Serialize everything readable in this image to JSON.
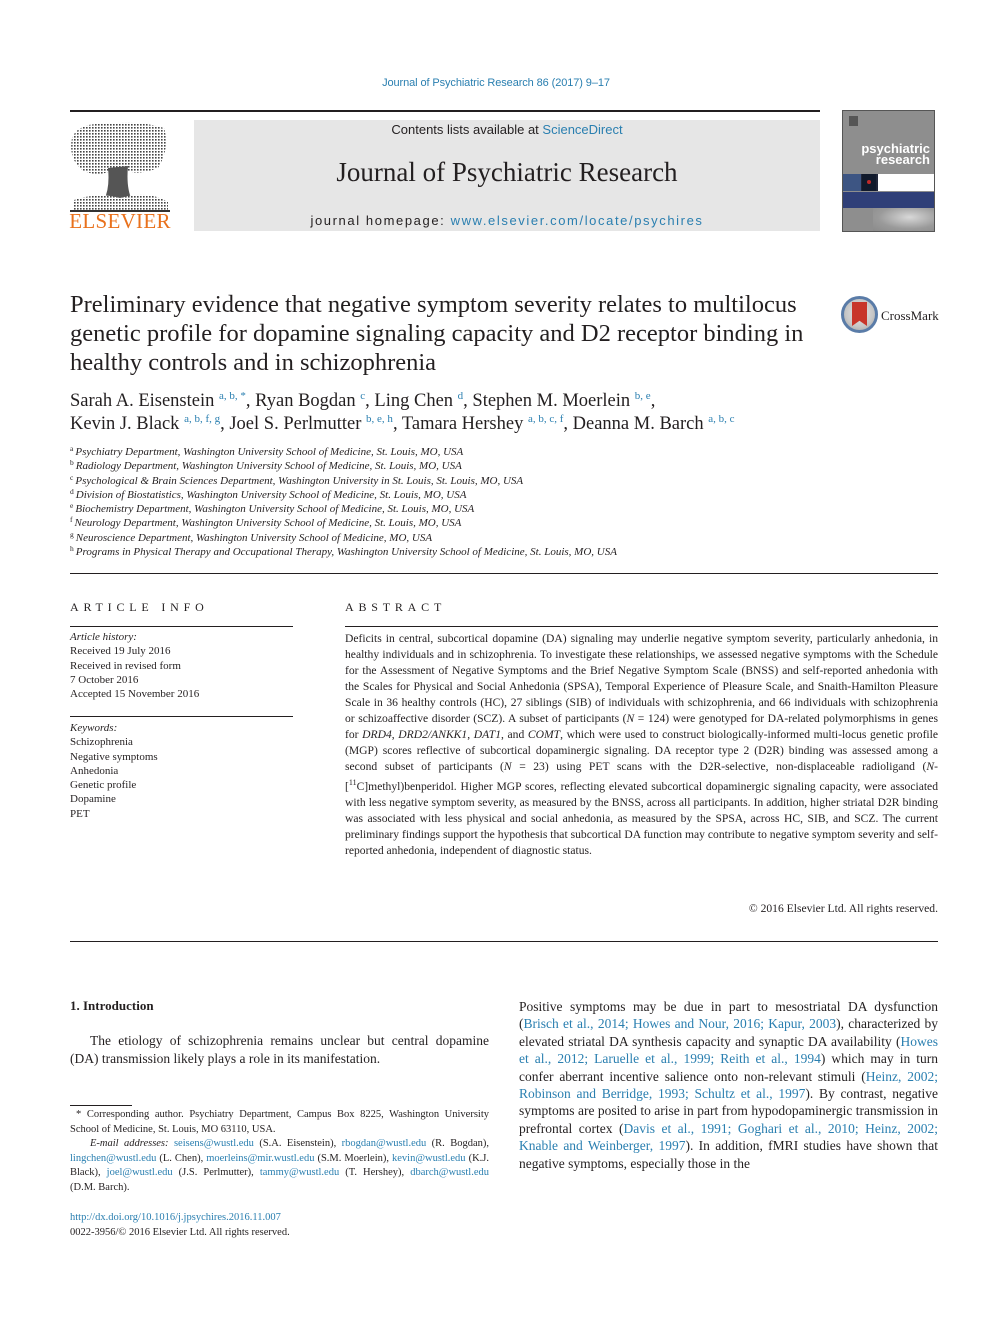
{
  "running_head": "Journal of Psychiatric Research 86 (2017) 9–17",
  "masthead": {
    "contents_prefix": "Contents lists available at ",
    "contents_link": "ScienceDirect",
    "journal_title": "Journal of Psychiatric Research",
    "homepage_prefix": "journal homepage: ",
    "homepage_link": "www.elsevier.com/locate/psychires",
    "publisher_logo": "ELSEVIER",
    "cover_title_line1": "psychiatric",
    "cover_title_line2": "research"
  },
  "crossmark_label": "CrossMark",
  "title": "Preliminary evidence that negative symptom severity relates to multilocus genetic profile for dopamine signaling capacity and D2 receptor binding in healthy controls and in schizophrenia",
  "authors": [
    {
      "name": "Sarah A. Eisenstein",
      "affil": "a, b, *",
      "sep": ", "
    },
    {
      "name": "Ryan Bogdan",
      "affil": "c",
      "sep": ", "
    },
    {
      "name": "Ling Chen",
      "affil": "d",
      "sep": ", "
    },
    {
      "name": "Stephen M. Moerlein",
      "affil": "b, e",
      "sep": ","
    },
    {
      "name": "Kevin J. Black",
      "affil": "a, b, f, g",
      "sep": ", "
    },
    {
      "name": "Joel S. Perlmutter",
      "affil": "b, e, h",
      "sep": ", "
    },
    {
      "name": "Tamara Hershey",
      "affil": "a, b, c, f",
      "sep": ", "
    },
    {
      "name": "Deanna M. Barch",
      "affil": "a, b, c",
      "sep": ""
    }
  ],
  "affiliations": [
    {
      "key": "a",
      "text": "Psychiatry Department, Washington University School of Medicine, St. Louis, MO, USA"
    },
    {
      "key": "b",
      "text": "Radiology Department, Washington University School of Medicine, St. Louis, MO, USA"
    },
    {
      "key": "c",
      "text": "Psychological & Brain Sciences Department, Washington University in St. Louis, St. Louis, MO, USA"
    },
    {
      "key": "d",
      "text": "Division of Biostatistics, Washington University School of Medicine, St. Louis, MO, USA"
    },
    {
      "key": "e",
      "text": "Biochemistry Department, Washington University School of Medicine, St. Louis, MO, USA"
    },
    {
      "key": "f",
      "text": "Neurology Department, Washington University School of Medicine, St. Louis, MO, USA"
    },
    {
      "key": "g",
      "text": "Neuroscience Department, Washington University School of Medicine, MO, USA"
    },
    {
      "key": "h",
      "text": "Programs in Physical Therapy and Occupational Therapy, Washington University School of Medicine, St. Louis, MO, USA"
    }
  ],
  "article_info": {
    "heading": "ARTICLE INFO",
    "history_label": "Article history:",
    "history": [
      "Received 19 July 2016",
      "Received in revised form",
      "7 October 2016",
      "Accepted 15 November 2016"
    ],
    "keywords_label": "Keywords:",
    "keywords": [
      "Schizophrenia",
      "Negative symptoms",
      "Anhedonia",
      "Genetic profile",
      "Dopamine",
      "PET"
    ]
  },
  "abstract": {
    "heading": "ABSTRACT",
    "p1": "Deficits in central, subcortical dopamine (DA) signaling may underlie negative symptom severity, particularly anhedonia, in healthy individuals and in schizophrenia. To investigate these relationships, we assessed negative symptoms with the Schedule for the Assessment of Negative Symptoms and the Brief Negative Symptom Scale (BNSS) and self-reported anhedonia with the Scales for Physical and Social Anhedonia (SPSA), Temporal Experience of Pleasure Scale, and Snaith-Hamilton Pleasure Scale in 36 healthy controls (HC), 27 siblings (SIB) of individuals with schizophrenia, and 66 individuals with schizophrenia or schizoaffective disorder (SCZ). A subset of participants (",
    "n1_var": "N",
    "n1_val": " = 124) were genotyped for DA-related polymorphisms in genes for ",
    "gene1": "DRD4",
    "sep1": ", ",
    "gene2": "DRD2/ANKK1",
    "sep2": ", ",
    "gene3": "DAT1",
    "sep3": ", and ",
    "gene4": "COMT",
    "p2": ", which were used to construct biologically-informed multi-locus genetic profile (MGP) scores reflective of subcortical dopaminergic signaling. DA receptor type 2 (D2R) binding was assessed among a second subset of participants (",
    "n2_var": "N",
    "n2_val": " = 23) using PET scans with the D2R-selective, non-displaceable radioligand (",
    "ligand_n": "N",
    "ligand_pre": "-[",
    "ligand_sup": "11",
    "p3": "C]methyl)benperidol. Higher MGP scores, reflecting elevated subcortical dopaminergic signaling capacity, were associated with less negative symptom severity, as measured by the BNSS, across all participants. In addition, higher striatal D2R binding was associated with less physical and social anhedonia, as measured by the SPSA, across HC, SIB, and SCZ. The current preliminary findings support the hypothesis that subcortical DA function may contribute to negative symptom severity and self-reported anhedonia, independent of diagnostic status.",
    "copyright": "© 2016 Elsevier Ltd. All rights reserved."
  },
  "introduction": {
    "heading": "1.  Introduction",
    "p1": "The etiology of schizophrenia remains unclear but central dopamine (DA) transmission likely plays a role in its manifestation.",
    "right_col": [
      {
        "t": "Positive symptoms may be due in part to mesostriatal DA dysfunction (",
        "link": false
      },
      {
        "t": "Brisch et al., 2014; Howes and Nour, 2016; Kapur, 2003",
        "link": true
      },
      {
        "t": "), characterized by elevated striatal DA synthesis capacity and synaptic DA availability (",
        "link": false
      },
      {
        "t": "Howes et al., 2012; Laruelle et al., 1999; Reith et al., 1994",
        "link": true
      },
      {
        "t": ") which may in turn confer aberrant incentive salience onto non-relevant stimuli (",
        "link": false
      },
      {
        "t": "Heinz, 2002; Robinson and Berridge, 1993; Schultz et al., 1997",
        "link": true
      },
      {
        "t": "). By contrast, negative symptoms are posited to arise in part from hypodopaminergic transmission in prefrontal cortex (",
        "link": false
      },
      {
        "t": "Davis et al., 1991; Goghari et al., 2010; Heinz, 2002; Knable and Weinberger, 1997",
        "link": true
      },
      {
        "t": "). In addition, fMRI studies have shown that negative symptoms, especially those in the",
        "link": false
      }
    ]
  },
  "footnote": {
    "corresponding": "* Corresponding author. Psychiatry Department, Campus Box 8225, Washington University School of Medicine, St. Louis, MO 63110, USA.",
    "email_label": "E-mail addresses:",
    "emails": [
      {
        "email": "seisens@wustl.edu",
        "who": " (S.A. Eisenstein), "
      },
      {
        "email": "rbogdan@wustl.edu",
        "who": " (R. Bogdan), "
      },
      {
        "email": "lingchen@wustl.edu",
        "who": " (L. Chen), "
      },
      {
        "email": "moerleins@mir.wustl.edu",
        "who": " (S.M. Moerlein), "
      },
      {
        "email": "kevin@wustl.edu",
        "who": " (K.J. Black), "
      },
      {
        "email": "joel@wustl.edu",
        "who": " (J.S. Perlmutter), "
      },
      {
        "email": "tammy@wustl.edu",
        "who": " (T. Hershey), "
      },
      {
        "email": "dbarch@wustl.edu",
        "who": " (D.M. Barch)."
      }
    ]
  },
  "doi": "http://dx.doi.org/10.1016/j.jpsychires.2016.11.007",
  "issn_line": "0022-3956/© 2016 Elsevier Ltd. All rights reserved.",
  "colors": {
    "link": "#2a7fb0",
    "elsevier_orange": "#e9711c",
    "masthead_bg": "#e6e6e6"
  }
}
